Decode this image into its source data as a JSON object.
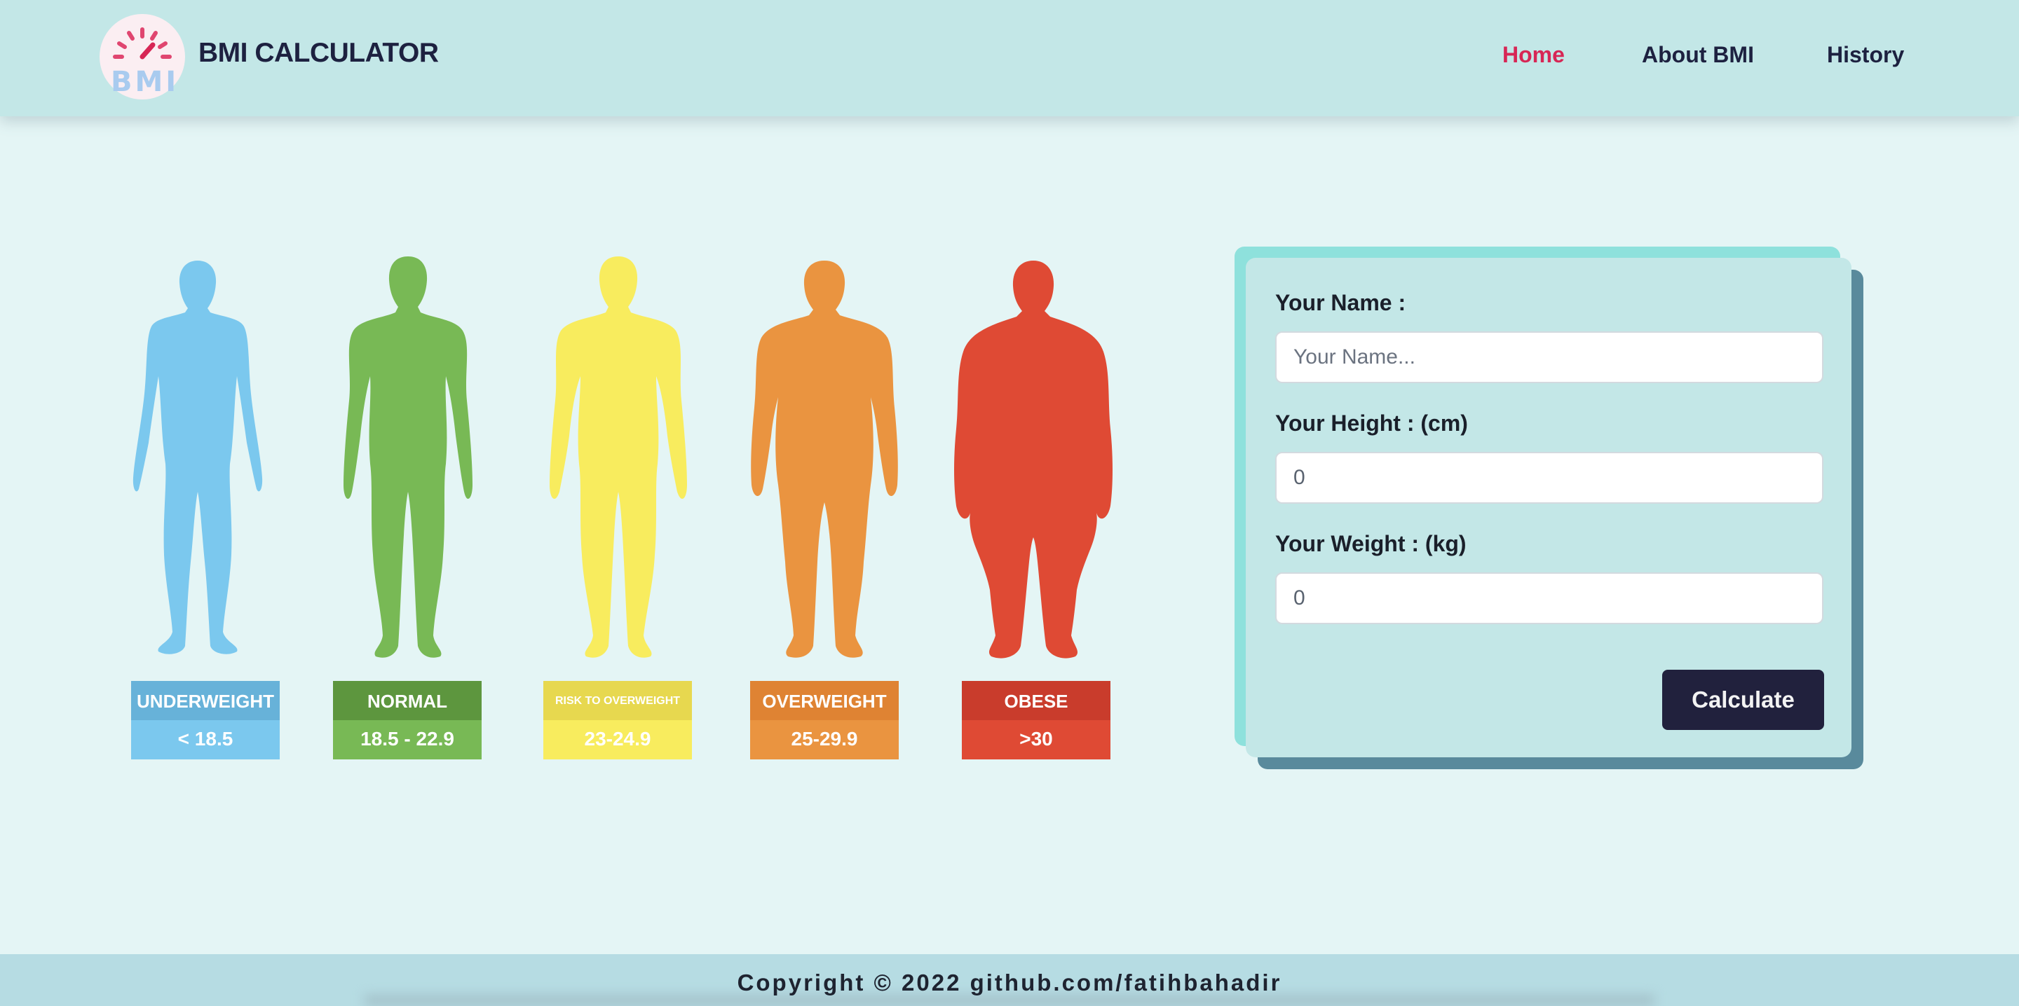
{
  "header": {
    "logo_text": "BMI",
    "brand": "BMI CALCULATOR",
    "nav": {
      "home": "Home",
      "about": "About BMI",
      "history": "History"
    },
    "active_nav": "home",
    "colors": {
      "active": "#d72655",
      "text": "#1d2140",
      "background": "#c3e7e7"
    }
  },
  "categories": [
    {
      "name": "UNDERWEIGHT",
      "range": "< 18.5",
      "color": "#7bc8ee",
      "label_color": "#67b2d9"
    },
    {
      "name": "NORMAL",
      "range": "18.5 - 22.9",
      "color": "#78b955",
      "label_color": "#5d963e"
    },
    {
      "name": "RISK TO OVERWEIGHT",
      "range": "23-24.9",
      "color": "#f8ec5e",
      "label_color": "#e7d84f"
    },
    {
      "name": "OVERWEIGHT",
      "range": "25-29.9",
      "color": "#ea9440",
      "label_color": "#df8333"
    },
    {
      "name": "OBESE",
      "range": ">30",
      "color": "#df4a34",
      "label_color": "#c93c2c"
    }
  ],
  "form": {
    "name_label": "Your Name :",
    "name_placeholder": "Your Name...",
    "height_label": "Your Height : (cm)",
    "height_value": "0",
    "weight_label": "Your Weight : (kg)",
    "weight_value": "0",
    "calculate_label": "Calculate"
  },
  "footer": {
    "copyright": "Copyright © 2022 github.com/fatihbahadir"
  }
}
